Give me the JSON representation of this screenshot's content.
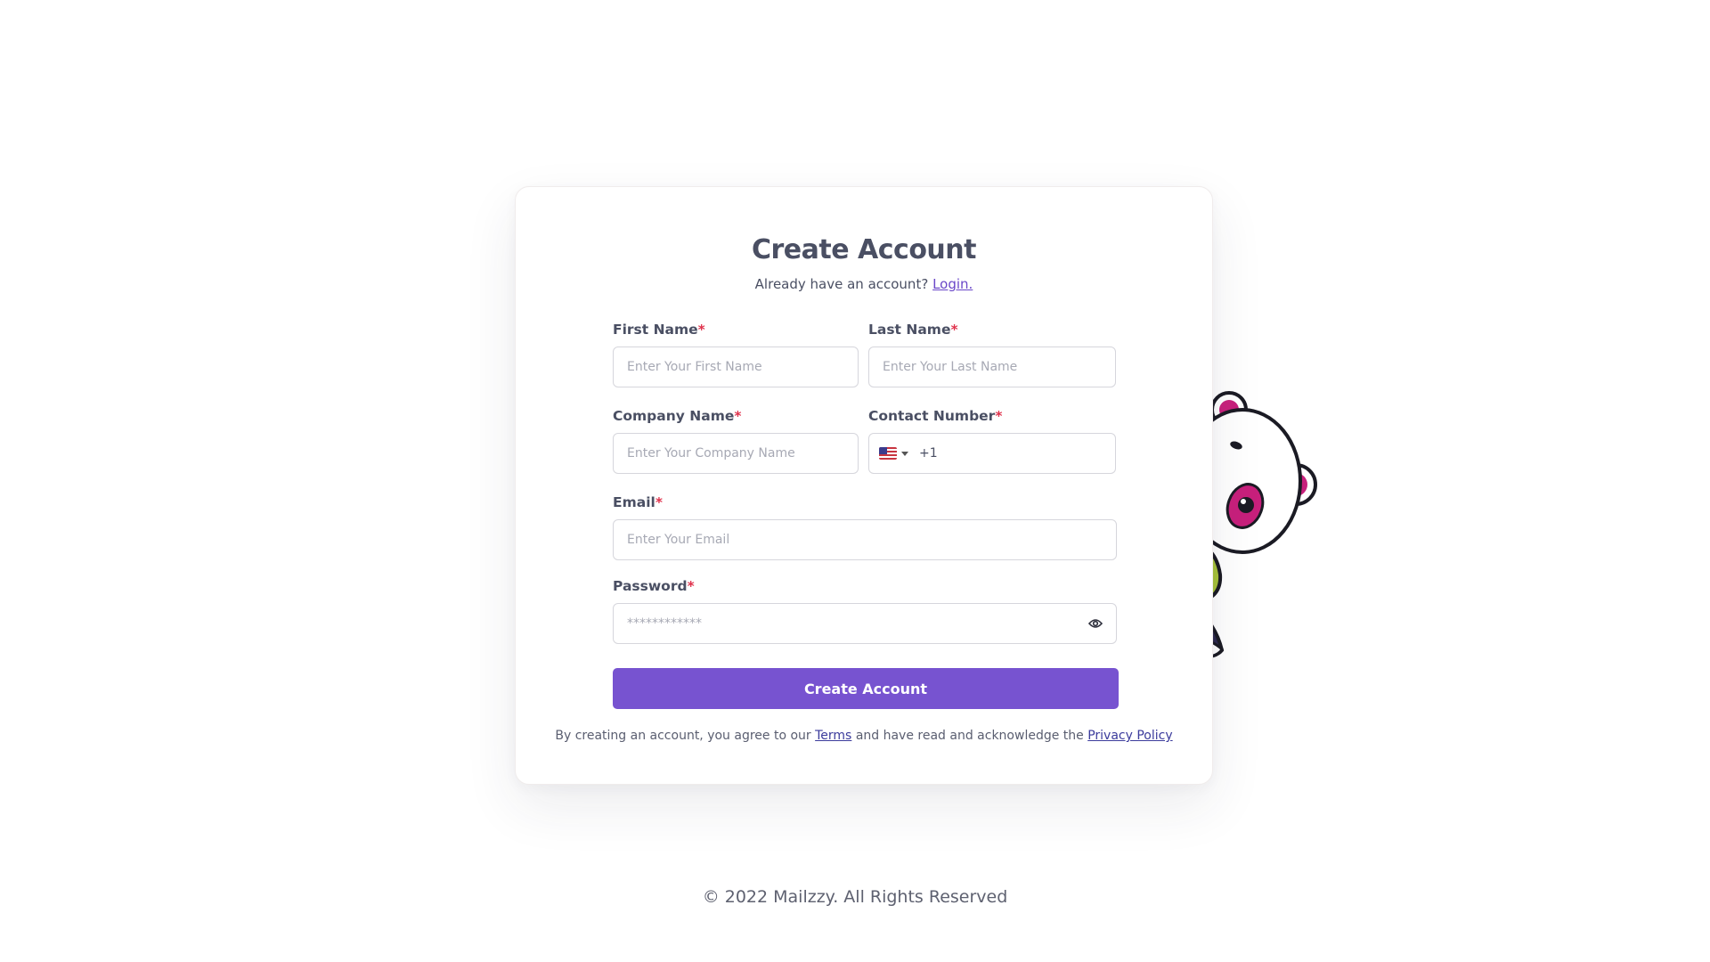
{
  "form": {
    "title": "Create Account",
    "subtitle_text": "Already have an account?",
    "login_link": "Login.",
    "fields": {
      "first_name": {
        "label": "First Name",
        "required_mark": "*",
        "placeholder": "Enter Your First Name",
        "value": ""
      },
      "last_name": {
        "label": "Last Name",
        "required_mark": "*",
        "placeholder": "Enter Your Last Name",
        "value": ""
      },
      "company_name": {
        "label": "Company Name",
        "required_mark": "*",
        "placeholder": "Enter Your Company Name",
        "value": ""
      },
      "contact_number": {
        "label": "Contact Number",
        "required_mark": "*",
        "country": "US",
        "dial_code": "+1",
        "value": ""
      },
      "email": {
        "label": "Email",
        "required_mark": "*",
        "placeholder": "Enter Your Email",
        "value": ""
      },
      "password": {
        "label": "Password",
        "required_mark": "*",
        "placeholder": "************",
        "value": ""
      }
    },
    "submit_label": "Create Account",
    "terms": {
      "prefix": "By creating an account, you agree to our",
      "terms_link": "Terms",
      "middle": "and have read and acknowledge the",
      "privacy_link": "Privacy Policy"
    }
  },
  "footer": {
    "copyright": "© 2022 Mailzzy. All Rights Reserved"
  },
  "icons": {
    "password_toggle": "eye-icon",
    "mascot": "panda-mascot",
    "flag": "us-flag-icon"
  },
  "colors": {
    "accent": "#7753d0",
    "required": "#e0334d",
    "link": "#3b3b9c",
    "mascot_pink": "#c8207c",
    "mascot_green": "#a8c43a"
  }
}
